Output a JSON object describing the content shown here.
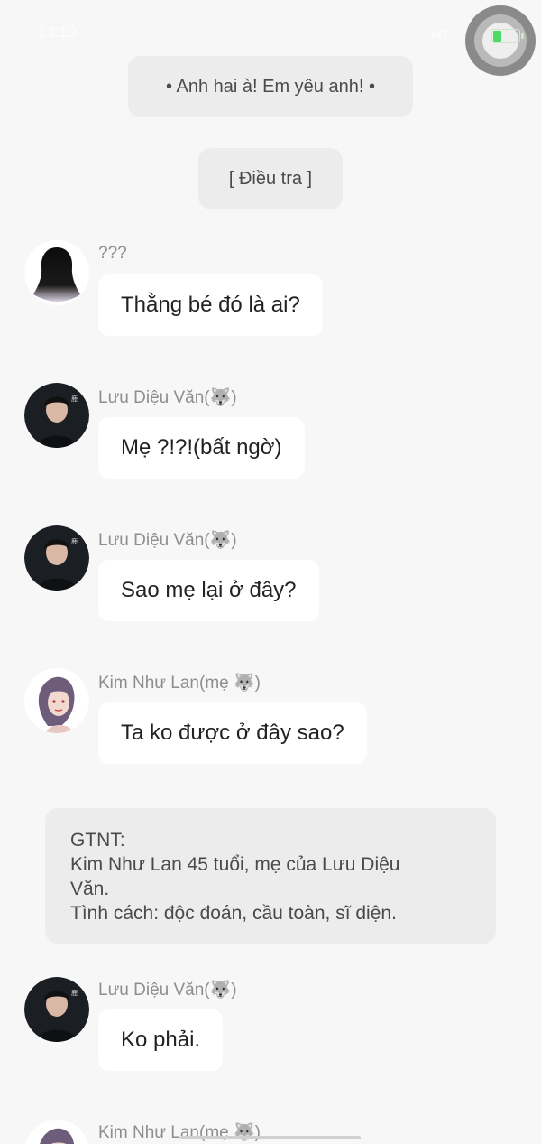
{
  "status_bar": {
    "time": "13:10",
    "signal": "4G"
  },
  "system_messages": [
    "• Anh hai à! Em yêu anh! •",
    "[ Điều tra ]"
  ],
  "messages": [
    {
      "sender": "???",
      "text": "Thằng bé đó là ai?",
      "avatar": "silhouette-avatar"
    },
    {
      "sender": "Lưu Diệu Văn(🐺)",
      "text": "Mẹ ?!?!(bất ngờ)",
      "avatar": "young-man-avatar"
    },
    {
      "sender": "Lưu Diệu Văn(🐺)",
      "text": "Sao mẹ lại ở đây?",
      "avatar": "young-man-avatar"
    },
    {
      "sender": "Kim Như Lan(mẹ 🐺)",
      "text": "Ta ko được ở đây sao?",
      "avatar": "woman-avatar"
    }
  ],
  "info_card": {
    "lines": [
      "GTNT:",
      "Kim Như Lan 45 tuổi, mẹ của Lưu Diệu",
      "Văn.",
      "Tình cách: độc đoán, cầu toàn, sĩ diện."
    ]
  },
  "messages_after": [
    {
      "sender": "Lưu Diệu Văn(🐺)",
      "text": "Ko phải.",
      "avatar": "young-man-avatar"
    },
    {
      "sender": "Kim Như Lan(mẹ 🐺)",
      "text": "",
      "avatar": "woman-avatar"
    }
  ],
  "colors": {
    "background": "#f7f7f7",
    "bubble": "#ffffff",
    "system_bubble": "#ececec",
    "sender_text": "#8e8e8e"
  }
}
